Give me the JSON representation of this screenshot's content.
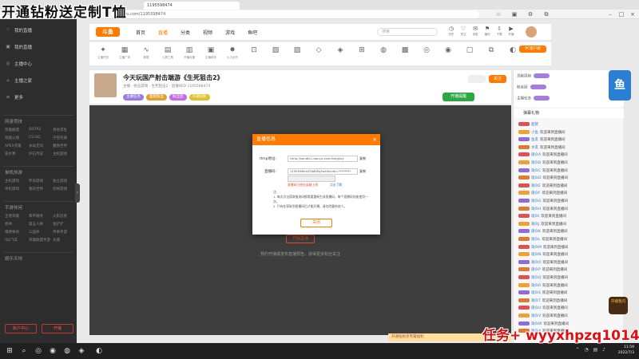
{
  "overlay": {
    "title": "开通钻粉送定制T恤",
    "watermark": "任务+ wyyxhpzq1014"
  },
  "browser": {
    "tab_title": "1195598474",
    "url": "douyu.com/1195598474"
  },
  "site_nav": {
    "logo": "斗鱼",
    "links": [
      "首页",
      "直播",
      "分类",
      "视频",
      "游戏",
      "鱼吧"
    ],
    "search_placeholder": "搜索",
    "icons": [
      {
        "icon": "history-icon",
        "label": "历史"
      },
      {
        "icon": "follow-icon",
        "label": "关注"
      },
      {
        "icon": "message-icon",
        "label": "消息"
      },
      {
        "icon": "gift-icon",
        "label": "福利"
      },
      {
        "icon": "download-icon",
        "label": "下载"
      },
      {
        "icon": "broadcast-icon",
        "label": "开播"
      }
    ],
    "pc_client": "PC客户端"
  },
  "category_strip": [
    "主播任务",
    "主播广场",
    "数据",
    "公屏工具",
    "开播设置",
    "主播助手",
    "火力全开",
    "",
    "",
    "",
    "",
    "",
    "",
    "",
    "",
    "",
    "",
    "",
    "",
    ""
  ],
  "sidebar": {
    "main": [
      {
        "icon": "home-icon",
        "label": "我的直播"
      },
      {
        "icon": "live-icon",
        "label": "我的直播"
      },
      {
        "icon": "center-icon",
        "label": "主播中心"
      },
      {
        "icon": "fans-icon",
        "label": "主播之家"
      },
      {
        "icon": "more-icon",
        "label": "更多"
      }
    ],
    "sections": [
      {
        "title": "网游竞技",
        "items": [
          "英雄联盟",
          "DOTA2",
          "绝地求生",
          "穿越火线",
          "CS:GO",
          "守望先锋",
          "APEX英雄",
          "永劫无间",
          "魔兽世界",
          "逆水寒",
          "炉石传说",
          "主机游戏"
        ]
      },
      {
        "title": "单机热游",
        "items": [
          "主机游戏",
          "怀旧游戏",
          "独立游戏",
          "单机游戏",
          "我的世界",
          "恐怖游戏"
        ]
      },
      {
        "title": "手游休闲",
        "items": [
          "王者荣耀",
          "和平精英",
          "火影忍者",
          "原神",
          "第五人格",
          "金铲铲",
          "棋牌休闲",
          "三国杀",
          "传奇手游",
          "QQ飞车",
          "英雄联盟手游",
          "光遇"
        ]
      },
      {
        "title": "娱乐天地",
        "items": []
      }
    ],
    "buttons": [
      "账户中心",
      "开播"
    ]
  },
  "room": {
    "title": "今天玩国产射击端游《生死狙击2》",
    "meta": "主播 · 射击游戏 · 生死狙击2 · 直播间ID 1195598474",
    "tags": [
      "主播任务",
      "超级粉丝",
      "粉丝团",
      "开通钻粉"
    ],
    "follow": "关注",
    "hot": "开播提醒"
  },
  "video": {
    "button": "开始直播",
    "tip": "预约开播或发布直播预告，获得更多粉丝关注"
  },
  "modal": {
    "title": "直播信息",
    "close": "×",
    "rtmp_label": "rtmp地址:",
    "rtmp_value": "rtmp://sendtc1.douyu.com/live/play",
    "code_label": "直播码:",
    "code_value": "1195598rmZGbBiEg?wsSecret=********",
    "copy": "复制",
    "warning": "直播码已经在该端上线",
    "more": "点击了解",
    "notes": [
      "注:",
      "1. 每次点击获取推流码都需要重新生成直播码，每个直播码仅能使用一次。",
      "2. 只有在获取到直播码后才能开播，请勿泄露给他人。"
    ],
    "confirm": "关闭"
  },
  "right_panel": {
    "rank_rows": [
      "贡献周榜",
      "粉丝团",
      "主播任务"
    ],
    "chat_title": "弹幕礼物",
    "chat": [
      {
        "name": "超管",
        "msg": ""
      },
      {
        "name": "小鱼",
        "msg": "欢迎来到直播间"
      },
      {
        "name": "鱼友",
        "msg": "欢迎来到直播间"
      },
      {
        "name": "水友",
        "msg": "欢迎来到直播间"
      },
      {
        "name": "观众A",
        "msg": "欢迎来到直播间"
      },
      {
        "name": "观众B",
        "msg": "欢迎来到直播间"
      },
      {
        "name": "观众C",
        "msg": "欢迎来到直播间"
      },
      {
        "name": "观众D",
        "msg": "欢迎来到直播间"
      },
      {
        "name": "观众E",
        "msg": "欢迎来到直播间"
      },
      {
        "name": "观众F",
        "msg": "欢迎来到直播间"
      },
      {
        "name": "观众G",
        "msg": "欢迎来到直播间"
      },
      {
        "name": "观众H",
        "msg": "欢迎来到直播间"
      },
      {
        "name": "观众I",
        "msg": "欢迎来到直播间"
      },
      {
        "name": "观众J",
        "msg": "欢迎来到直播间"
      },
      {
        "name": "观众K",
        "msg": "欢迎来到直播间"
      },
      {
        "name": "观众L",
        "msg": "欢迎来到直播间"
      },
      {
        "name": "观众M",
        "msg": "欢迎来到直播间"
      },
      {
        "name": "观众N",
        "msg": "欢迎来到直播间"
      },
      {
        "name": "观众O",
        "msg": "欢迎来到直播间"
      },
      {
        "name": "观众P",
        "msg": "欢迎来到直播间"
      },
      {
        "name": "观众Q",
        "msg": "欢迎来到直播间"
      },
      {
        "name": "观众R",
        "msg": "欢迎来到直播间"
      },
      {
        "name": "观众S",
        "msg": "欢迎来到直播间"
      },
      {
        "name": "观众T",
        "msg": "欢迎来到直播间"
      },
      {
        "name": "观众U",
        "msg": "欢迎来到直播间"
      },
      {
        "name": "观众V",
        "msg": "欢迎来到直播间"
      },
      {
        "name": "观众W",
        "msg": "欢迎来到直播间"
      },
      {
        "name": "观众X",
        "msg": "欢迎来到直播间"
      }
    ],
    "ticket": "开通钻粉享专属福利",
    "anchor_badge": "开播我闪"
  },
  "taskbar": {
    "time": "11:59",
    "date": "2022/7/3"
  },
  "colors": {
    "accent": "#ff7a00",
    "sidebar": "#2d2d2d",
    "video_bg": "#3e3e3e",
    "watermark": "#e01010",
    "warning": "#e04f2c"
  }
}
